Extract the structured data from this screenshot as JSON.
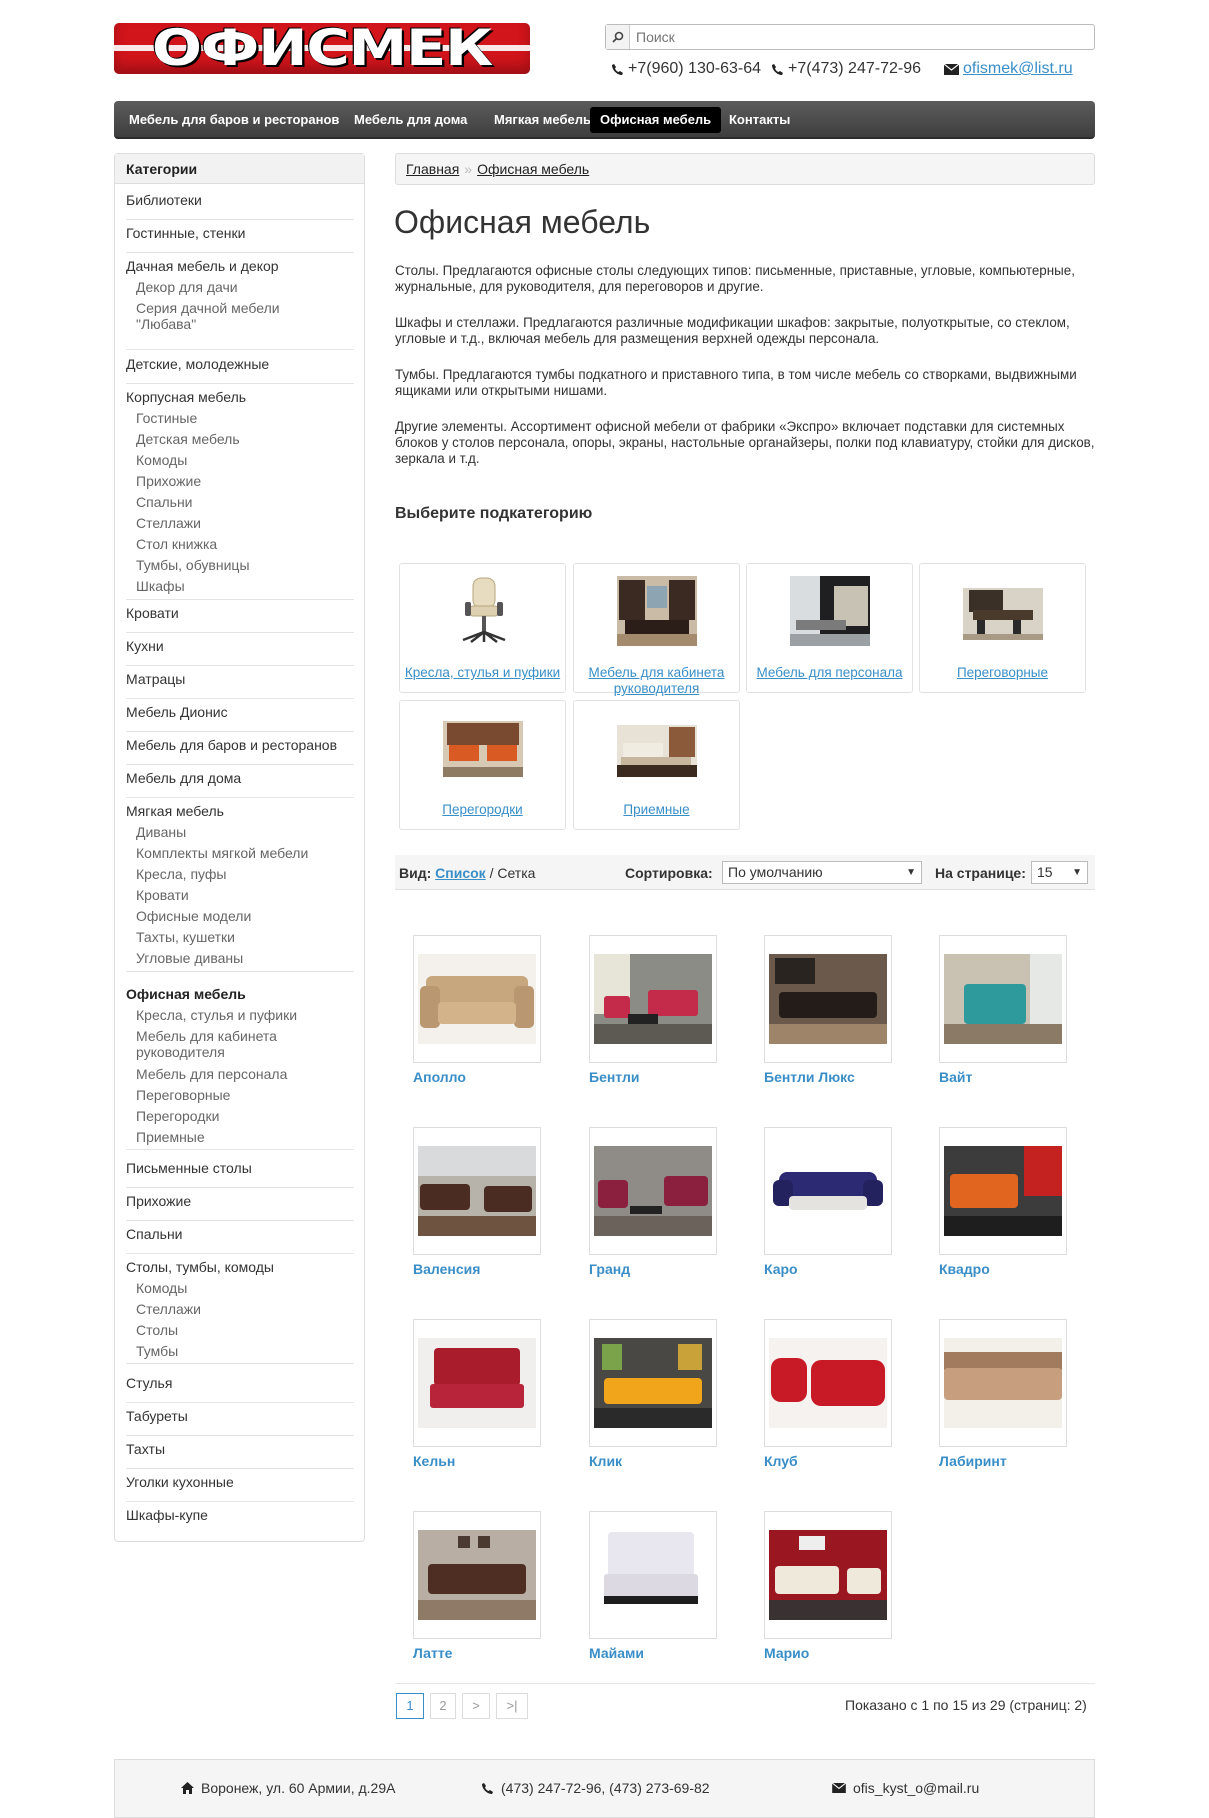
{
  "header": {
    "logo_text": "ОФИСМЕК",
    "search_placeholder": "Поиск",
    "phone1": "+7(960) 130-63-64",
    "phone2": "+7(473) 247-72-96",
    "email": "ofismek@list.ru"
  },
  "nav": {
    "items": [
      "Мебель для баров и ресторанов",
      "Мебель для дома",
      "Мягкая мебель",
      "Офисная мебель",
      "Контакты"
    ],
    "active_index": 3
  },
  "sidebar": {
    "title": "Категории",
    "c1": "Библиотеки",
    "c2": "Гостинные, стенки",
    "c3": "Дачная мебель и декор",
    "c3_s1": "Декор для дачи",
    "c3_s2": "Серия дачной мебели \"Любава\"",
    "c4": "Детские, молодежные",
    "c5": "Корпусная мебель",
    "c5_subs": [
      "Гостиные",
      "Детская мебель",
      "Комоды",
      "Прихожие",
      "Спальни",
      "Стеллажи",
      "Стол книжка",
      "Тумбы, обувницы",
      "Шкафы"
    ],
    "c6": "Кровати",
    "c7": "Кухни",
    "c8": "Матрацы",
    "c9": "Мебель Дионис",
    "c10": "Мебель для баров и ресторанов",
    "c11": "Мебель для дома",
    "c12": "Мягкая мебель",
    "c12_subs": [
      "Диваны",
      "Комплекты мягкой мебели",
      "Кресла, пуфы",
      "Кровати",
      "Офисные модели",
      "Тахты, кушетки",
      "Угловые диваны"
    ],
    "c13": "Офисная мебель",
    "c13_s1": "Кресла, стулья и пуфики",
    "c13_s2": "Мебель для кабинета руководителя",
    "c13_subs": [
      "Мебель для персонала",
      "Переговорные",
      "Перегородки",
      "Приемные"
    ],
    "c14": "Письменные столы",
    "c15": "Прихожие",
    "c16": "Спальни",
    "c17": "Столы, тумбы, комоды",
    "c17_subs": [
      "Комоды",
      "Стеллажи",
      "Столы",
      "Тумбы"
    ],
    "c18": "Стулья",
    "c19": "Табуреты",
    "c20": "Тахты",
    "c21": "Уголки кухонные",
    "c22": "Шкафы-купе"
  },
  "breadcrumb": {
    "home": "Главная",
    "sep": "»",
    "current": "Офисная мебель"
  },
  "main": {
    "title": "Офисная мебель",
    "p1": "Столы. Предлагаются офисные столы следующих типов: письменные, приставные, угловые, компьютерные, журнальные, для руководителя, для переговоров и другие.",
    "p2": "Шкафы и стеллажи. Предлагаются различные модификации шкафов: закрытые, полуоткрытые, со стеклом, угловые и т.д., включая мебель для размещения верхней одежды персонала.",
    "p3": "Тумбы. Предлагаются тумбы подкатного и приставного типа, в том числе мебель со створками, выдвижными ящиками или открытыми нишами.",
    "p4": "Другие элементы. Ассортимент офисной мебели от фабрики «Экспро» включает подставки для системных блоков у столов персонала, опоры, экраны, настольные органайзеры, полки под клавиатуру, стойки для дисков, зеркала и т.д.",
    "subcat_title": "Выберите подкатегорию",
    "subcats": [
      "Кресла, стулья и пуфики",
      "Мебель для кабинета руководителя",
      "Мебель для персонала",
      "Переговорные",
      "Перегородки",
      "Приемные"
    ]
  },
  "toolbar": {
    "view_label": "Вид:",
    "view_list": "Список",
    "view_sep": "/",
    "view_grid": "Сетка",
    "sort_label": "Сортировка:",
    "sort_value": "По умолчанию",
    "per_page_label": "На странице:",
    "per_page_value": "15",
    "arrow": "▼"
  },
  "products": [
    "Аполло",
    "Бентли",
    "Бентли Люкс",
    "Вайт",
    "Валенсия",
    "Гранд",
    "Каро",
    "Квадро",
    "Кельн",
    "Клик",
    "Клуб",
    "Лабиринт",
    "Латте",
    "Майами",
    "Марио"
  ],
  "pagination": {
    "pages": [
      "1",
      "2",
      ">",
      ">|"
    ],
    "current": 1,
    "info": "Показано с 1 по 15 из 29 (страниц: 2)"
  },
  "footer": {
    "address": "Воронеж, ул. 60 Армии, д.29А",
    "phones": "(473) 247-72-96, (473) 273-69-82",
    "email": "ofis_kyst_o@mail.ru"
  },
  "colors": {
    "link": "#3a8ec8",
    "logo_red": "#d2141b",
    "nav_bg": "#4a4a4a"
  }
}
